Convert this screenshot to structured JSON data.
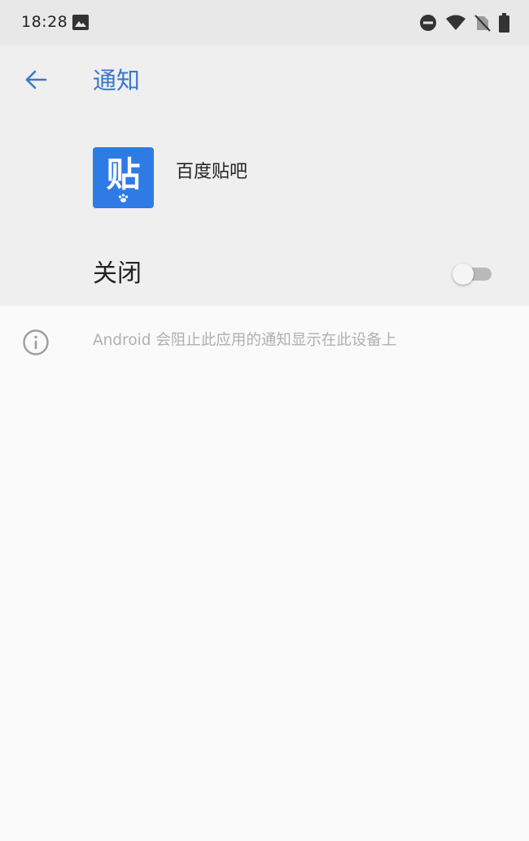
{
  "status_bar": {
    "time": "18:28",
    "icons": [
      "gallery-icon",
      "do-not-disturb-icon",
      "wifi-icon",
      "no-sim-icon",
      "battery-icon"
    ]
  },
  "header": {
    "title": "通知",
    "back_icon": "arrow-left-icon"
  },
  "app": {
    "name": "百度贴吧",
    "icon_glyph": "贴",
    "icon_color": "#2f7be6"
  },
  "toggle": {
    "label": "关闭",
    "state": "off"
  },
  "info": {
    "icon": "info-icon",
    "text": "Android 会阻止此应用的通知显示在此设备上"
  },
  "colors": {
    "accent": "#3a78c9",
    "status_bar_bg": "#e8e8e8",
    "panel_bg": "#efefef",
    "page_bg": "#fafafa"
  }
}
